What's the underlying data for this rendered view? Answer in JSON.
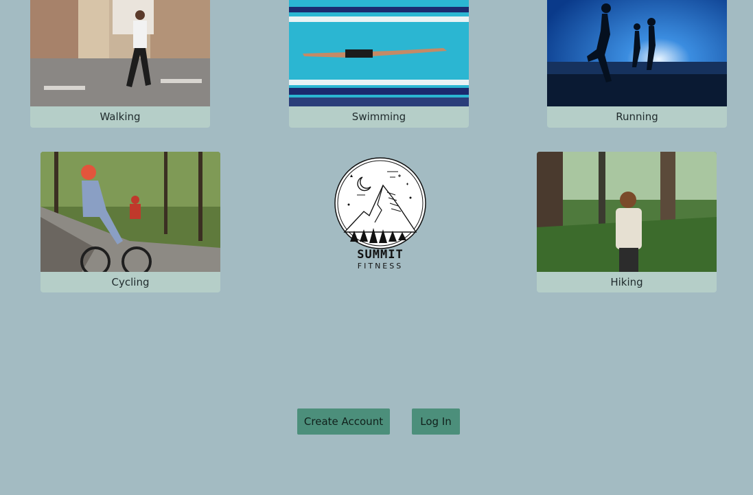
{
  "activities": {
    "walking": "Walking",
    "swimming": "Swimming",
    "running": "Running",
    "cycling": "Cycling",
    "hiking": "Hiking"
  },
  "brand": {
    "name": "SUMMIT",
    "tagline": "FITNESS"
  },
  "actions": {
    "create_account": "Create Account",
    "log_in": "Log In"
  },
  "colors": {
    "background": "#a3bbc2",
    "card_label_bg": "#b5cec8",
    "button_bg": "#4c8f7b"
  }
}
